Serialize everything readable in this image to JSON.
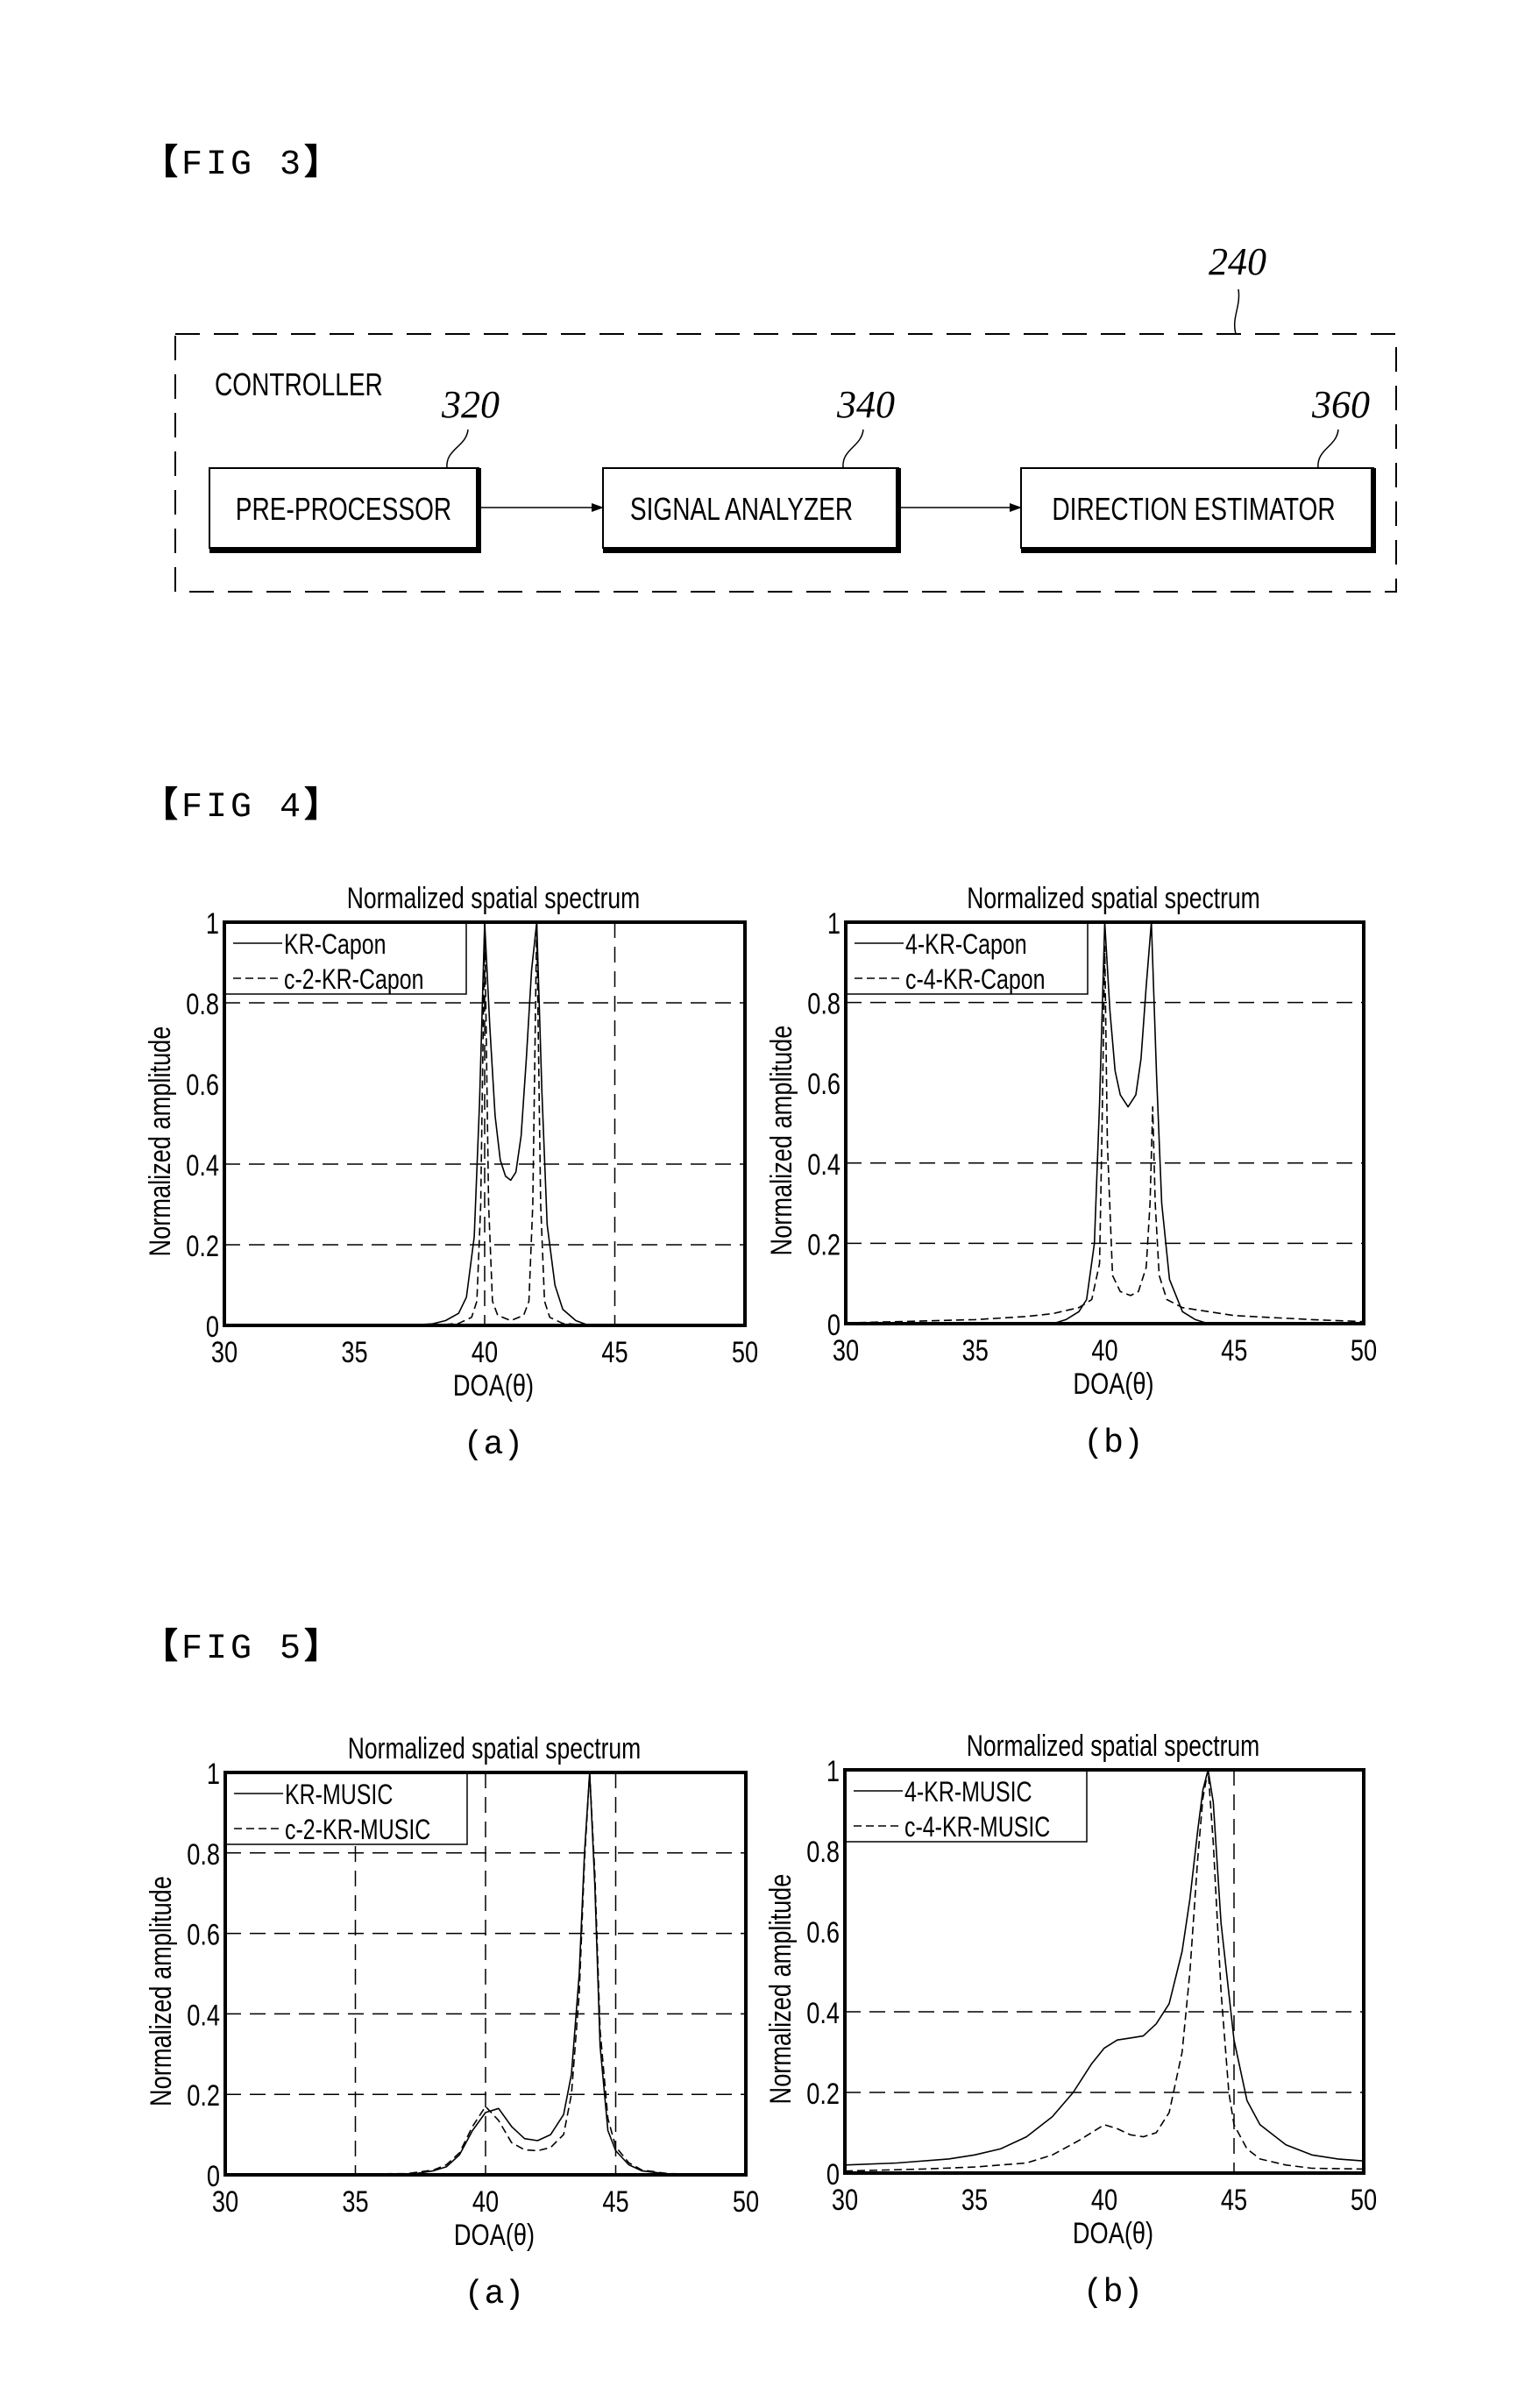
{
  "figures": {
    "fig3": {
      "label": "FIG 3",
      "diagram": {
        "container_ref": "240",
        "container_title": "CONTROLLER",
        "blocks": [
          {
            "ref": "320",
            "label": "PRE-PROCESSOR"
          },
          {
            "ref": "340",
            "label": "SIGNAL ANALYZER"
          },
          {
            "ref": "360",
            "label": "DIRECTION ESTIMATOR"
          }
        ],
        "flow": [
          "PRE-PROCESSOR -> SIGNAL ANALYZER",
          "SIGNAL ANALYZER -> DIRECTION ESTIMATOR"
        ]
      }
    },
    "fig4": {
      "label": "FIG 4"
    },
    "fig5": {
      "label": "FIG 5"
    }
  },
  "chart_data": [
    {
      "id": "fig4a",
      "type": "line",
      "title": "Normalized spatial spectrum",
      "xlabel": "DOA(θ)",
      "ylabel": "Normalized amplitude",
      "caption": "(a)",
      "xlim": [
        30,
        50
      ],
      "ylim": [
        0,
        1
      ],
      "xticks": [
        "30",
        "35",
        "40",
        "45",
        "50"
      ],
      "yticks": [
        "0",
        "0.2",
        "0.4",
        "0.6",
        "0.8",
        "1"
      ],
      "grid_x": [
        40,
        45
      ],
      "grid_y": [
        0.2,
        0.4,
        0.8
      ],
      "legend": "top-left",
      "series": [
        {
          "name": "KR-Capon",
          "style": "solid",
          "x": [
            30,
            37,
            38,
            38.5,
            39,
            39.3,
            39.6,
            39.8,
            40,
            40.2,
            40.4,
            40.6,
            40.8,
            41,
            41.2,
            41.4,
            41.6,
            41.8,
            42,
            42.2,
            42.4,
            42.7,
            43,
            43.5,
            44,
            50
          ],
          "y": [
            0,
            0,
            0.004,
            0.012,
            0.03,
            0.07,
            0.22,
            0.55,
            1.0,
            0.74,
            0.52,
            0.41,
            0.37,
            0.36,
            0.38,
            0.47,
            0.66,
            0.88,
            1.0,
            0.58,
            0.25,
            0.1,
            0.04,
            0.012,
            0,
            0
          ]
        },
        {
          "name": "c-2-KR-Capon",
          "style": "dashed",
          "x": [
            30,
            38,
            39,
            39.5,
            39.7,
            39.85,
            40,
            40.15,
            40.3,
            40.5,
            41,
            41.5,
            41.7,
            41.85,
            42,
            42.15,
            42.3,
            42.5,
            43,
            44,
            50
          ],
          "y": [
            0,
            0,
            0.005,
            0.02,
            0.06,
            0.3,
            1.0,
            0.3,
            0.06,
            0.025,
            0.012,
            0.025,
            0.06,
            0.3,
            1.0,
            0.3,
            0.06,
            0.02,
            0.005,
            0,
            0
          ]
        }
      ]
    },
    {
      "id": "fig4b",
      "type": "line",
      "title": "Normalized spatial spectrum",
      "xlabel": "DOA(θ)",
      "ylabel": "Normalized amplitude",
      "caption": "(b)",
      "xlim": [
        30,
        50
      ],
      "ylim": [
        0,
        1
      ],
      "xticks": [
        "30",
        "35",
        "40",
        "45",
        "50"
      ],
      "yticks": [
        "0",
        "0.2",
        "0.4",
        "0.6",
        "0.8",
        "1"
      ],
      "grid_x": [],
      "grid_y": [
        0.2,
        0.4,
        0.8
      ],
      "legend": "top-left",
      "series": [
        {
          "name": "4-KR-Capon",
          "style": "solid",
          "x": [
            30,
            38,
            38.5,
            39,
            39.3,
            39.6,
            39.8,
            40,
            40.2,
            40.4,
            40.6,
            40.9,
            41.2,
            41.4,
            41.6,
            41.8,
            42,
            42.2,
            42.5,
            43,
            43.5,
            44,
            50
          ],
          "y": [
            0,
            0,
            0.01,
            0.03,
            0.06,
            0.2,
            0.55,
            1.0,
            0.78,
            0.63,
            0.57,
            0.54,
            0.57,
            0.66,
            0.84,
            1.0,
            0.62,
            0.3,
            0.11,
            0.03,
            0.01,
            0,
            0
          ]
        },
        {
          "name": "c-4-KR-Capon",
          "style": "dashed",
          "x": [
            30,
            32,
            35,
            37,
            38,
            39,
            39.5,
            39.8,
            39.9,
            40,
            40.1,
            40.3,
            40.6,
            41,
            41.3,
            41.6,
            41.75,
            41.85,
            41.95,
            42.1,
            42.4,
            43,
            45,
            48,
            50
          ],
          "y": [
            0.002,
            0.005,
            0.01,
            0.018,
            0.025,
            0.04,
            0.06,
            0.15,
            0.5,
            0.94,
            0.45,
            0.12,
            0.08,
            0.07,
            0.08,
            0.14,
            0.3,
            0.54,
            0.3,
            0.12,
            0.06,
            0.04,
            0.02,
            0.01,
            0.005
          ]
        }
      ]
    },
    {
      "id": "fig5a",
      "type": "line",
      "title": "Normalized spatial spectrum",
      "xlabel": "DOA(θ)",
      "ylabel": "Normalized amplitude",
      "caption": "(a)",
      "xlim": [
        30,
        50
      ],
      "ylim": [
        0,
        1
      ],
      "xticks": [
        "30",
        "35",
        "40",
        "45",
        "50"
      ],
      "yticks": [
        "0",
        "0.2",
        "0.4",
        "0.6",
        "0.8",
        "1"
      ],
      "grid_x": [
        35,
        40,
        45
      ],
      "grid_y": [
        0.2,
        0.4,
        0.6,
        0.8
      ],
      "legend": "top-left",
      "series": [
        {
          "name": "KR-MUSIC",
          "style": "solid",
          "x": [
            30,
            37,
            38,
            38.5,
            39,
            39.5,
            40,
            40.5,
            41,
            41.5,
            42,
            42.5,
            43,
            43.3,
            43.6,
            43.8,
            44,
            44.2,
            44.4,
            44.7,
            45,
            45.5,
            46,
            47,
            50
          ],
          "y": [
            0,
            0,
            0.01,
            0.02,
            0.05,
            0.11,
            0.155,
            0.165,
            0.12,
            0.09,
            0.085,
            0.1,
            0.15,
            0.25,
            0.5,
            0.8,
            1.0,
            0.72,
            0.32,
            0.11,
            0.06,
            0.025,
            0.01,
            0.002,
            0
          ]
        },
        {
          "name": "c-2-KR-MUSIC",
          "style": "dashed",
          "x": [
            30,
            37,
            38,
            38.5,
            39,
            39.5,
            40,
            40.5,
            41,
            41.5,
            42,
            42.5,
            43,
            43.3,
            43.6,
            43.8,
            44,
            44.2,
            44.4,
            44.7,
            45,
            45.5,
            46,
            47,
            50
          ],
          "y": [
            0,
            0.003,
            0.012,
            0.025,
            0.055,
            0.12,
            0.17,
            0.135,
            0.08,
            0.062,
            0.06,
            0.068,
            0.1,
            0.2,
            0.45,
            0.78,
            1.0,
            0.75,
            0.36,
            0.14,
            0.07,
            0.03,
            0.012,
            0.003,
            0
          ]
        }
      ]
    },
    {
      "id": "fig5b",
      "type": "line",
      "title": "Normalized spatial spectrum",
      "xlabel": "DOA(θ)",
      "ylabel": "Normalized amplitude",
      "caption": "(b)",
      "xlim": [
        30,
        50
      ],
      "ylim": [
        0,
        1
      ],
      "xticks": [
        "30",
        "35",
        "40",
        "45",
        "50"
      ],
      "yticks": [
        "0",
        "0.2",
        "0.4",
        "0.6",
        "0.8",
        "1"
      ],
      "grid_x": [
        45
      ],
      "grid_y": [
        0.2,
        0.4
      ],
      "legend": "top-left",
      "series": [
        {
          "name": "4-KR-MUSIC",
          "style": "solid",
          "x": [
            30,
            32,
            34,
            35,
            36,
            37,
            38,
            38.8,
            39.5,
            40,
            40.5,
            41,
            41.5,
            42,
            42.5,
            43,
            43.3,
            43.6,
            43.8,
            44,
            44.2,
            44.5,
            45,
            45.5,
            46,
            47,
            48,
            49,
            50
          ],
          "y": [
            0.02,
            0.025,
            0.035,
            0.045,
            0.06,
            0.09,
            0.14,
            0.2,
            0.27,
            0.31,
            0.33,
            0.335,
            0.34,
            0.37,
            0.42,
            0.55,
            0.68,
            0.85,
            0.95,
            1.0,
            0.92,
            0.62,
            0.33,
            0.18,
            0.12,
            0.07,
            0.045,
            0.035,
            0.03
          ]
        },
        {
          "name": "c-4-KR-MUSIC",
          "style": "dashed",
          "x": [
            30,
            33,
            35,
            36,
            37,
            38,
            39,
            40,
            40.5,
            41,
            41.5,
            42,
            42.5,
            43,
            43.3,
            43.6,
            43.8,
            44,
            44.2,
            44.5,
            44.8,
            45,
            45.5,
            46,
            47,
            48,
            50
          ],
          "y": [
            0.005,
            0.01,
            0.015,
            0.02,
            0.025,
            0.045,
            0.08,
            0.12,
            0.11,
            0.095,
            0.09,
            0.1,
            0.15,
            0.3,
            0.5,
            0.78,
            0.93,
            1.0,
            0.82,
            0.45,
            0.2,
            0.12,
            0.06,
            0.035,
            0.02,
            0.012,
            0.01
          ]
        }
      ]
    }
  ]
}
